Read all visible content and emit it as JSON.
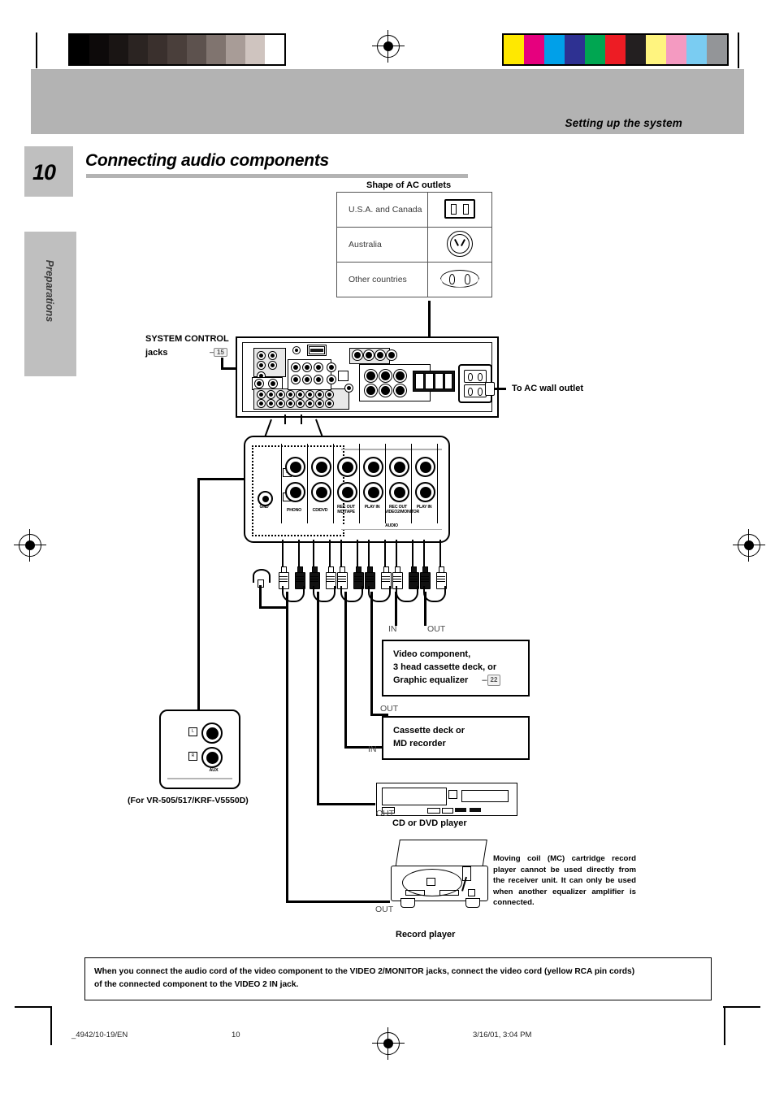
{
  "page": {
    "number": "10",
    "running_head": "Setting up the system",
    "side_tab": "Preparations",
    "title": "Connecting audio components"
  },
  "ac_outlets": {
    "caption": "Shape of AC outlets",
    "rows": [
      {
        "region": "U.S.A. and Canada",
        "shape": "us-flat-blade-outlet-icon"
      },
      {
        "region": "Australia",
        "shape": "australia-round-outlet-icon"
      },
      {
        "region": "Other countries",
        "shape": "europlug-outlet-icon"
      }
    ]
  },
  "rear_panel": {
    "system_control_label_line1": "SYSTEM CONTROL",
    "system_control_label_line2": "jacks",
    "system_control_page_ref": "15",
    "ac_outlet_label": "To AC wall outlet"
  },
  "terminal_detail": {
    "ground_label": "GND",
    "left_tag": "L",
    "right_tag": "R",
    "bus_label": "AUDIO",
    "jacks": [
      {
        "label": "PHONO",
        "sub": ""
      },
      {
        "label": "CD/DVD",
        "sub": ""
      },
      {
        "label": "REC OUT",
        "sub": "MD/TAPE"
      },
      {
        "label": "PLAY IN",
        "sub": ""
      },
      {
        "label": "REC OUT",
        "sub": "VIDEO2/MONITOR"
      },
      {
        "label": "PLAY IN",
        "sub": ""
      }
    ]
  },
  "aux_panel": {
    "jack_label": "AUX",
    "left_tag": "L",
    "right_tag": "R",
    "model_note": "(For VR-505/517/KRF-V5550D)"
  },
  "components": {
    "video_component": {
      "in_label": "IN",
      "out_label": "OUT",
      "line1": "Video component,",
      "line2": "3 head cassette deck, or",
      "line3": "Graphic equalizer",
      "page_ref": "22"
    },
    "cassette_deck": {
      "in_label": "IN",
      "out_label": "OUT",
      "line1": "Cassette deck or",
      "line2": "MD recorder"
    },
    "cd_player": {
      "out_label": "OUT",
      "caption": "CD or DVD player"
    },
    "record_player": {
      "out_label": "OUT",
      "caption": "Record player",
      "warning": "Moving coil (MC) cartridge record player cannot be used directly from the receiver unit. It can only be used when another equalizer amplifier is connected."
    }
  },
  "bottom_note": {
    "line1": "When you connect the audio cord of the video component to the VIDEO 2/MONITOR jacks, connect the video cord (yellow RCA pin cords)",
    "line2": "of the connected component to the VIDEO 2 IN jack."
  },
  "footer": {
    "file_ref": "_4942/10-19/EN",
    "page_number": "10",
    "timestamp": "3/16/01, 3:04 PM"
  },
  "calibration": {
    "grey_steps": [
      "#000000",
      "#0d0a0a",
      "#1a1514",
      "#2b2422",
      "#3a302d",
      "#4a3f3b",
      "#5d524e",
      "#80746f",
      "#a89c97",
      "#cfc4bf",
      "#ffffff"
    ],
    "color_steps": [
      "#ffe800",
      "#e6007e",
      "#00a0e9",
      "#2e3192",
      "#00a651",
      "#ed1c24",
      "#231f20",
      "#fff47f",
      "#f49ac1",
      "#7accf2",
      "#939598"
    ]
  },
  "colors": {
    "band": "#b3b3b3",
    "tab": "#bfbfbf",
    "rule": "#b3b3b3"
  }
}
